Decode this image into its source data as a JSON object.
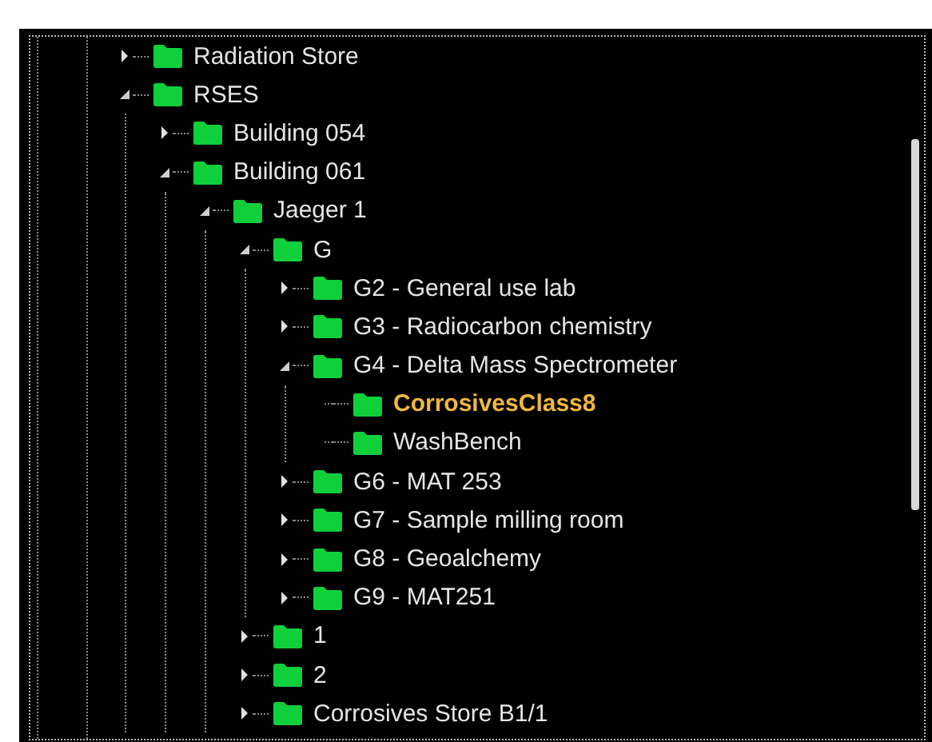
{
  "tree": {
    "items": [
      {
        "label": "Radiation Store",
        "kind": "branch",
        "expanded": false,
        "selected": false
      },
      {
        "label": "RSES",
        "kind": "branch",
        "expanded": true,
        "selected": false,
        "children": [
          {
            "label": "Building 054",
            "kind": "branch",
            "expanded": false,
            "selected": false
          },
          {
            "label": "Building 061",
            "kind": "branch",
            "expanded": true,
            "selected": false,
            "children": [
              {
                "label": "Jaeger 1",
                "kind": "branch",
                "expanded": true,
                "selected": false,
                "children": [
                  {
                    "label": "G",
                    "kind": "branch",
                    "expanded": true,
                    "selected": false,
                    "children": [
                      {
                        "label": "G2 - General use lab",
                        "kind": "branch",
                        "expanded": false,
                        "selected": false
                      },
                      {
                        "label": "G3 - Radiocarbon chemistry",
                        "kind": "branch",
                        "expanded": false,
                        "selected": false
                      },
                      {
                        "label": "G4 - Delta Mass Spectrometer",
                        "kind": "branch",
                        "expanded": true,
                        "selected": false,
                        "children": [
                          {
                            "label": "CorrosivesClass8",
                            "kind": "leaf",
                            "selected": true
                          },
                          {
                            "label": "WashBench",
                            "kind": "leaf",
                            "selected": false
                          }
                        ]
                      },
                      {
                        "label": "G6 - MAT 253",
                        "kind": "branch",
                        "expanded": false,
                        "selected": false
                      },
                      {
                        "label": "G7 - Sample milling room",
                        "kind": "branch",
                        "expanded": false,
                        "selected": false
                      },
                      {
                        "label": "G8 - Geoalchemy",
                        "kind": "branch",
                        "expanded": false,
                        "selected": false
                      },
                      {
                        "label": "G9 - MAT251",
                        "kind": "branch",
                        "expanded": false,
                        "selected": false
                      }
                    ]
                  },
                  {
                    "label": "1",
                    "kind": "branch",
                    "expanded": false,
                    "selected": false
                  },
                  {
                    "label": "2",
                    "kind": "branch",
                    "expanded": false,
                    "selected": false
                  },
                  {
                    "label": "Corrosives Store B1/1",
                    "kind": "branch",
                    "expanded": false,
                    "selected": false
                  }
                ]
              }
            ]
          }
        ]
      }
    ]
  }
}
